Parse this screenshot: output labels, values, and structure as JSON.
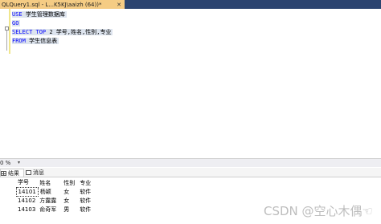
{
  "document_tab": {
    "title": "QLQuery1.sql - L...K5KJ\\aaizh (64))*",
    "close_glyph": "✕"
  },
  "editor": {
    "lines": [
      {
        "keyword": "USE",
        "rest": " 学生管理数据库"
      },
      {
        "keyword": "GO",
        "rest": ""
      },
      {
        "keyword": "SELECT TOP",
        "rest": " 2 学号,姓名,性别,专业"
      },
      {
        "keyword": "FROM",
        "rest": " 学生信息表"
      }
    ]
  },
  "zoom": {
    "value": "0 %",
    "caret": "▾"
  },
  "results_tabs": [
    {
      "label": "结果",
      "icon": "results-grid-icon",
      "active": true
    },
    {
      "label": "消息",
      "icon": "messages-icon",
      "active": false
    }
  ],
  "results": {
    "columns": [
      "学号",
      "姓名",
      "性别",
      "专业"
    ],
    "rows": [
      {
        "row_no": "",
        "cells": [
          "14101",
          "杨颖",
          "女",
          "软件"
        ]
      },
      {
        "row_no": "",
        "cells": [
          "14102",
          "方露露",
          "女",
          "软件"
        ]
      },
      {
        "row_no": "",
        "cells": [
          "14103",
          "俞奇军",
          "男",
          "软件"
        ]
      }
    ]
  },
  "watermark": "CSDN @空心木偶☜",
  "colors": {
    "tab_strip": "#2b4470",
    "active_tab": "#f5cc84",
    "keyword": "#0000ff",
    "selection": "#dde4ee"
  }
}
